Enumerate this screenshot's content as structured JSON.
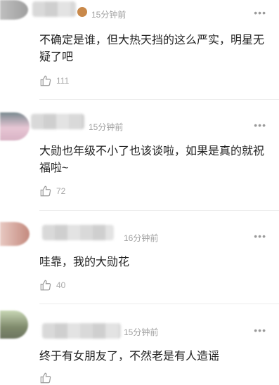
{
  "comments": [
    {
      "time": "15分钟前",
      "more": "•••",
      "text": "不确定是谁，但大热天挡的这么严实，明星无疑了吧",
      "likes": "111"
    },
    {
      "time": "15分钟前",
      "more": "•••",
      "text": "大勋也年级不小了也该谈啦，如果是真的就祝福啦~",
      "likes": "72"
    },
    {
      "time": "16分钟前",
      "more": "•••",
      "text": "哇靠，我的大勋花",
      "likes": "40"
    },
    {
      "time": "15分钟前",
      "more": "•••",
      "text": "终于有女朋友了，不然老是有人造谣",
      "likes": ""
    }
  ]
}
